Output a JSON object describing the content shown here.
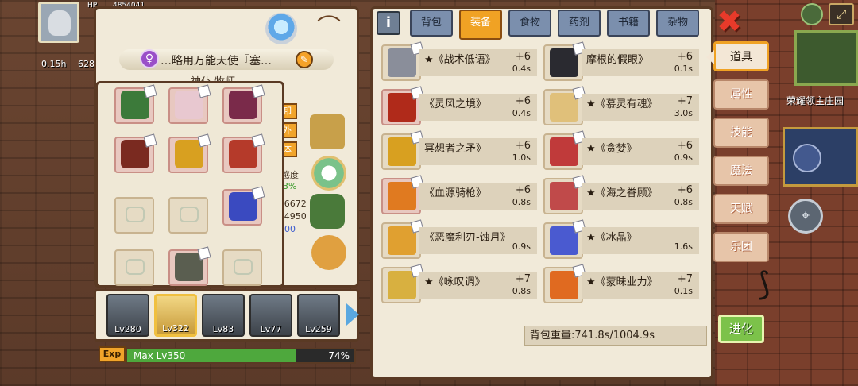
{
  "player": {
    "hp_label": "HP",
    "hp_value": "4854041",
    "time": "0.15h",
    "count": "628"
  },
  "character": {
    "title": "…略用万能天使『塞…",
    "subtitle": "神仆 牧师",
    "side_tags": [
      "卸",
      "外",
      "体"
    ],
    "side_texts": [
      "感度",
      "3%",
      "/6672",
      "/4950",
      "00"
    ]
  },
  "equipment_slots": [
    {
      "name": "slot-accessory",
      "filled": true,
      "color": "#3c7a3a"
    },
    {
      "name": "slot-wings",
      "filled": true,
      "color": "#e8c8d0"
    },
    {
      "name": "slot-cloak",
      "filled": true,
      "color": "#7a2a4a"
    },
    {
      "name": "slot-belt",
      "filled": true,
      "color": "#7a2a20"
    },
    {
      "name": "slot-boots",
      "filled": true,
      "color": "#d8a020"
    },
    {
      "name": "slot-gauntlets",
      "filled": true,
      "color": "#b53a2a"
    },
    {
      "name": "slot-empty-1",
      "filled": false
    },
    {
      "name": "slot-empty-2",
      "filled": false
    },
    {
      "name": "slot-gem",
      "filled": true,
      "color": "#3a4ac0"
    },
    {
      "name": "slot-empty-3",
      "filled": false
    },
    {
      "name": "slot-armor",
      "filled": true,
      "color": "#5a5e50"
    },
    {
      "name": "slot-empty-4",
      "filled": false
    }
  ],
  "party": [
    {
      "level": "Lv280",
      "active": false
    },
    {
      "level": "Lv322",
      "active": true
    },
    {
      "level": "Lv83",
      "active": false
    },
    {
      "level": "Lv77",
      "active": false
    },
    {
      "level": "Lv259",
      "active": false
    }
  ],
  "exp": {
    "tag": "Exp",
    "label": "Max Lv350",
    "percent_text": "74%",
    "percent": 74
  },
  "tabs": [
    {
      "label": "背包",
      "active": false
    },
    {
      "label": "装备",
      "active": true
    },
    {
      "label": "食物",
      "active": false
    },
    {
      "label": "药剂",
      "active": false
    },
    {
      "label": "书籍",
      "active": false
    },
    {
      "label": "杂物",
      "active": false
    }
  ],
  "items": [
    {
      "name": "★《战术低语》",
      "plus": "+6",
      "weight": "0.4s",
      "color": "#8a8e9a",
      "red": false
    },
    {
      "name": "摩根的假眼》",
      "plus": "+6",
      "weight": "0.1s",
      "color": "#2a2a30",
      "red": false
    },
    {
      "name": "《灵风之境》",
      "plus": "+6",
      "weight": "0.4s",
      "color": "#b02a1a",
      "red": true
    },
    {
      "name": "★《慕灵有魂》",
      "plus": "+7",
      "weight": "3.0s",
      "color": "#e0c07a",
      "red": false
    },
    {
      "name": "冥想者之矛》",
      "plus": "+6",
      "weight": "1.0s",
      "color": "#d8a020",
      "red": false
    },
    {
      "name": "★《贪婪》",
      "plus": "+6",
      "weight": "0.9s",
      "color": "#c03a3a",
      "red": false
    },
    {
      "name": "《血源骑枪》",
      "plus": "+6",
      "weight": "0.8s",
      "color": "#e07a20",
      "red": true
    },
    {
      "name": "★《海之眷顾》",
      "plus": "+6",
      "weight": "0.8s",
      "color": "#c04a4a",
      "red": false
    },
    {
      "name": "《恶魔利刃-蚀月》",
      "plus": "",
      "weight": "0.9s",
      "color": "#e0a030",
      "red": false
    },
    {
      "name": "★《冰晶》",
      "plus": "",
      "weight": "1.6s",
      "color": "#4a5ad0",
      "red": false
    },
    {
      "name": "★《咏叹调》",
      "plus": "+7",
      "weight": "0.8s",
      "color": "#d8b040",
      "red": false
    },
    {
      "name": "★《蒙昧业力》",
      "plus": "+7",
      "weight": "0.1s",
      "color": "#e06a20",
      "red": false
    }
  ],
  "bag_weight": "背包重量:741.8s/1004.9s",
  "side_menu": [
    {
      "label": "道具",
      "active": true
    },
    {
      "label": "属性",
      "active": false
    },
    {
      "label": "技能",
      "active": false
    },
    {
      "label": "魔法",
      "active": false
    },
    {
      "label": "天赋",
      "active": false
    },
    {
      "label": "乐团",
      "active": false
    }
  ],
  "evolve_label": "进化",
  "map_label": "荣耀领主庄园",
  "close_symbol": "✖"
}
